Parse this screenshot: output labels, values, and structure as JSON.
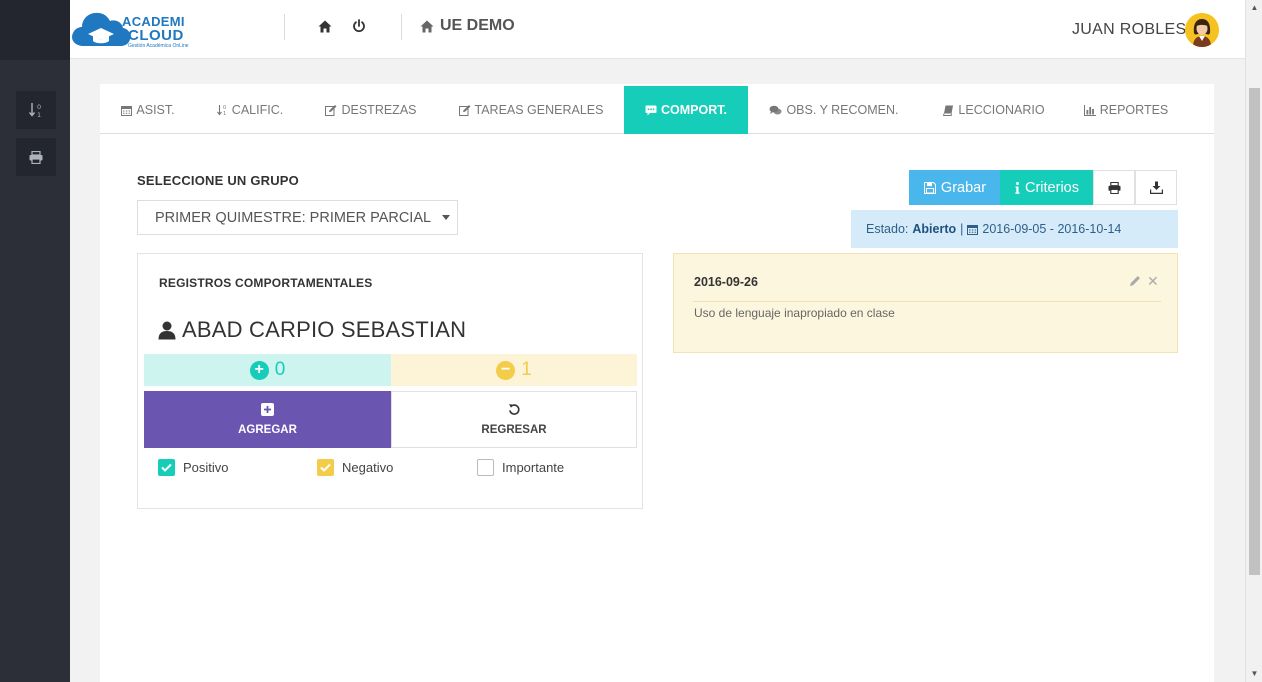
{
  "brand": {
    "line1": "ACADEMI",
    "line2": "CLOUD",
    "tagline": "Gestión Académica OnLine"
  },
  "header": {
    "school_name": "UE DEMO",
    "user_name": "JUAN ROBLES"
  },
  "tabs": [
    {
      "label": "Asist.",
      "icon": "calendar-icon"
    },
    {
      "label": "Calific.",
      "icon": "sort-numeric-icon"
    },
    {
      "label": "Destrezas",
      "icon": "edit-icon"
    },
    {
      "label": "Tareas Generales",
      "icon": "edit-icon"
    },
    {
      "label": "Comport.",
      "icon": "comment-icon",
      "active": true
    },
    {
      "label": "Obs. y Recomen.",
      "icon": "comments-icon"
    },
    {
      "label": "Leccionario",
      "icon": "book-icon"
    },
    {
      "label": "Reportes",
      "icon": "bar-chart-icon"
    }
  ],
  "group": {
    "label": "SELECCIONE UN GRUPO",
    "selected": "PRIMER QUIMESTRE: PRIMER PARCIAL"
  },
  "toolbar": {
    "save_label": "Grabar",
    "criteria_label": "Criterios"
  },
  "estado": {
    "prefix": "Estado:",
    "value": "Abierto",
    "separator": "|",
    "date_range": "2016-09-05 - 2016-10-14"
  },
  "registros": {
    "title": "REGISTROS COMPORTAMENTALES",
    "student": "ABAD CARPIO SEBASTIAN",
    "positive_count": "0",
    "negative_count": "1",
    "add_label": "AGREGAR",
    "back_label": "REGRESAR",
    "checkboxes": [
      {
        "label": "Positivo",
        "checked": true,
        "color": "#16cdb9"
      },
      {
        "label": "Negativo",
        "checked": true,
        "color": "#f3cc4a"
      },
      {
        "label": "Importante",
        "checked": false,
        "color": "#ffffff"
      }
    ]
  },
  "note": {
    "date": "2016-09-26",
    "text": "Uso de lenguaje inapropiado en clase"
  },
  "colors": {
    "accent": "#16cdb9",
    "primary_blue": "#49b6ec",
    "purple": "#6a55b0",
    "sidebar": "#2c2f38",
    "warning_bg": "#fdf6de",
    "info_bg": "#d6ebfa"
  }
}
